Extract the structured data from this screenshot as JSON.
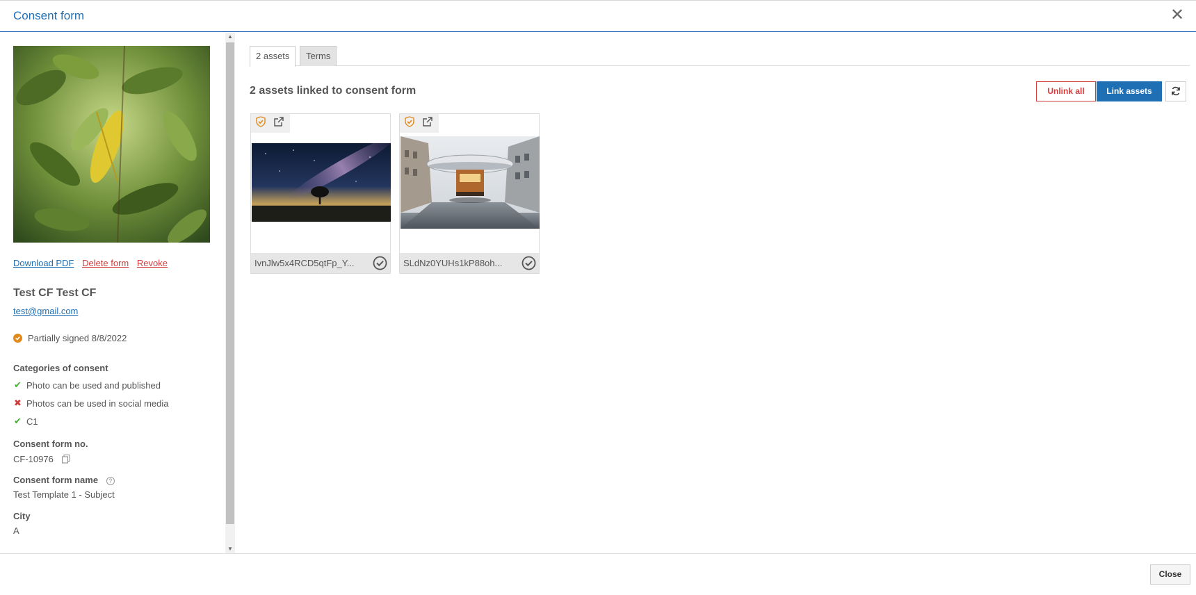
{
  "header": {
    "title": "Consent form",
    "close_glyph": "✕"
  },
  "left": {
    "links": {
      "download": "Download PDF",
      "delete": "Delete form",
      "revoke": "Revoke"
    },
    "person": {
      "name": "Test CF Test CF",
      "email": "test@gmail.com"
    },
    "status": {
      "text": "Partially signed 8/8/2022",
      "color": "#e08a1b"
    },
    "categories": {
      "label": "Categories of consent",
      "items": [
        {
          "label": "Photo can be used and published",
          "granted": true
        },
        {
          "label": "Photos can be used in social media",
          "granted": false
        },
        {
          "label": "C1",
          "granted": true
        }
      ]
    },
    "form_no": {
      "label": "Consent form no.",
      "value": "CF-10976"
    },
    "form_name": {
      "label": "Consent form name",
      "value": "Test Template 1 - Subject"
    },
    "city": {
      "label": "City",
      "value": "A"
    }
  },
  "right": {
    "tabs": [
      {
        "label": "2 assets",
        "active": true
      },
      {
        "label": "Terms",
        "active": false
      }
    ],
    "heading": "2 assets linked to consent form",
    "buttons": {
      "unlink_all": "Unlink all",
      "link_assets": "Link assets"
    },
    "assets": [
      {
        "filename": "IvnJlw5x4RCD5qtFp_Y...",
        "thumb": "night-sky-tree"
      },
      {
        "filename": "SLdNz0YUHs1kP88oh...",
        "thumb": "city-street-ufo"
      }
    ]
  },
  "footer": {
    "close_label": "Close"
  },
  "colors": {
    "accent": "#1f6fb5",
    "danger": "#d23b3b",
    "success": "#4caa3a",
    "warning": "#e08a1b"
  }
}
